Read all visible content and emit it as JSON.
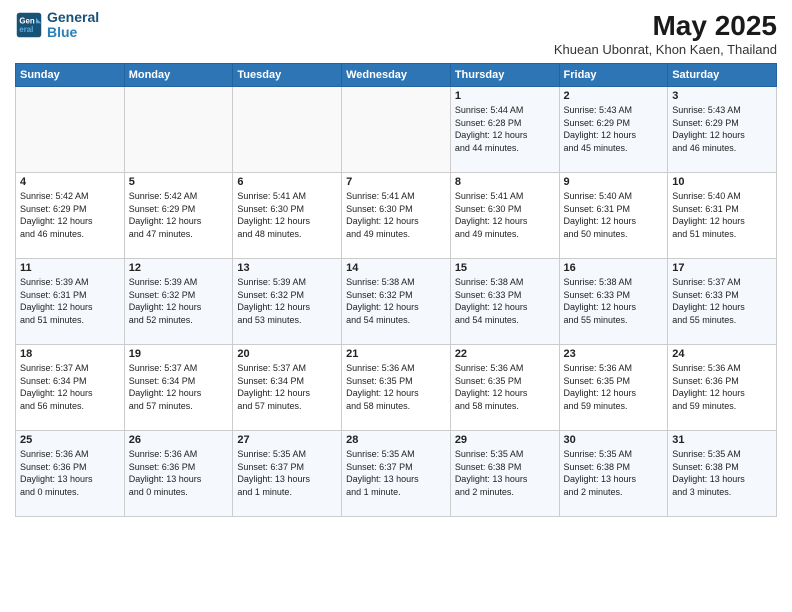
{
  "header": {
    "logo_line1": "General",
    "logo_line2": "Blue",
    "title": "May 2025",
    "subtitle": "Khuean Ubonrat, Khon Kaen, Thailand"
  },
  "days_of_week": [
    "Sunday",
    "Monday",
    "Tuesday",
    "Wednesday",
    "Thursday",
    "Friday",
    "Saturday"
  ],
  "weeks": [
    [
      {
        "day": "",
        "info": ""
      },
      {
        "day": "",
        "info": ""
      },
      {
        "day": "",
        "info": ""
      },
      {
        "day": "",
        "info": ""
      },
      {
        "day": "1",
        "info": "Sunrise: 5:44 AM\nSunset: 6:28 PM\nDaylight: 12 hours\nand 44 minutes."
      },
      {
        "day": "2",
        "info": "Sunrise: 5:43 AM\nSunset: 6:29 PM\nDaylight: 12 hours\nand 45 minutes."
      },
      {
        "day": "3",
        "info": "Sunrise: 5:43 AM\nSunset: 6:29 PM\nDaylight: 12 hours\nand 46 minutes."
      }
    ],
    [
      {
        "day": "4",
        "info": "Sunrise: 5:42 AM\nSunset: 6:29 PM\nDaylight: 12 hours\nand 46 minutes."
      },
      {
        "day": "5",
        "info": "Sunrise: 5:42 AM\nSunset: 6:29 PM\nDaylight: 12 hours\nand 47 minutes."
      },
      {
        "day": "6",
        "info": "Sunrise: 5:41 AM\nSunset: 6:30 PM\nDaylight: 12 hours\nand 48 minutes."
      },
      {
        "day": "7",
        "info": "Sunrise: 5:41 AM\nSunset: 6:30 PM\nDaylight: 12 hours\nand 49 minutes."
      },
      {
        "day": "8",
        "info": "Sunrise: 5:41 AM\nSunset: 6:30 PM\nDaylight: 12 hours\nand 49 minutes."
      },
      {
        "day": "9",
        "info": "Sunrise: 5:40 AM\nSunset: 6:31 PM\nDaylight: 12 hours\nand 50 minutes."
      },
      {
        "day": "10",
        "info": "Sunrise: 5:40 AM\nSunset: 6:31 PM\nDaylight: 12 hours\nand 51 minutes."
      }
    ],
    [
      {
        "day": "11",
        "info": "Sunrise: 5:39 AM\nSunset: 6:31 PM\nDaylight: 12 hours\nand 51 minutes."
      },
      {
        "day": "12",
        "info": "Sunrise: 5:39 AM\nSunset: 6:32 PM\nDaylight: 12 hours\nand 52 minutes."
      },
      {
        "day": "13",
        "info": "Sunrise: 5:39 AM\nSunset: 6:32 PM\nDaylight: 12 hours\nand 53 minutes."
      },
      {
        "day": "14",
        "info": "Sunrise: 5:38 AM\nSunset: 6:32 PM\nDaylight: 12 hours\nand 54 minutes."
      },
      {
        "day": "15",
        "info": "Sunrise: 5:38 AM\nSunset: 6:33 PM\nDaylight: 12 hours\nand 54 minutes."
      },
      {
        "day": "16",
        "info": "Sunrise: 5:38 AM\nSunset: 6:33 PM\nDaylight: 12 hours\nand 55 minutes."
      },
      {
        "day": "17",
        "info": "Sunrise: 5:37 AM\nSunset: 6:33 PM\nDaylight: 12 hours\nand 55 minutes."
      }
    ],
    [
      {
        "day": "18",
        "info": "Sunrise: 5:37 AM\nSunset: 6:34 PM\nDaylight: 12 hours\nand 56 minutes."
      },
      {
        "day": "19",
        "info": "Sunrise: 5:37 AM\nSunset: 6:34 PM\nDaylight: 12 hours\nand 57 minutes."
      },
      {
        "day": "20",
        "info": "Sunrise: 5:37 AM\nSunset: 6:34 PM\nDaylight: 12 hours\nand 57 minutes."
      },
      {
        "day": "21",
        "info": "Sunrise: 5:36 AM\nSunset: 6:35 PM\nDaylight: 12 hours\nand 58 minutes."
      },
      {
        "day": "22",
        "info": "Sunrise: 5:36 AM\nSunset: 6:35 PM\nDaylight: 12 hours\nand 58 minutes."
      },
      {
        "day": "23",
        "info": "Sunrise: 5:36 AM\nSunset: 6:35 PM\nDaylight: 12 hours\nand 59 minutes."
      },
      {
        "day": "24",
        "info": "Sunrise: 5:36 AM\nSunset: 6:36 PM\nDaylight: 12 hours\nand 59 minutes."
      }
    ],
    [
      {
        "day": "25",
        "info": "Sunrise: 5:36 AM\nSunset: 6:36 PM\nDaylight: 13 hours\nand 0 minutes."
      },
      {
        "day": "26",
        "info": "Sunrise: 5:36 AM\nSunset: 6:36 PM\nDaylight: 13 hours\nand 0 minutes."
      },
      {
        "day": "27",
        "info": "Sunrise: 5:35 AM\nSunset: 6:37 PM\nDaylight: 13 hours\nand 1 minute."
      },
      {
        "day": "28",
        "info": "Sunrise: 5:35 AM\nSunset: 6:37 PM\nDaylight: 13 hours\nand 1 minute."
      },
      {
        "day": "29",
        "info": "Sunrise: 5:35 AM\nSunset: 6:38 PM\nDaylight: 13 hours\nand 2 minutes."
      },
      {
        "day": "30",
        "info": "Sunrise: 5:35 AM\nSunset: 6:38 PM\nDaylight: 13 hours\nand 2 minutes."
      },
      {
        "day": "31",
        "info": "Sunrise: 5:35 AM\nSunset: 6:38 PM\nDaylight: 13 hours\nand 3 minutes."
      }
    ]
  ]
}
